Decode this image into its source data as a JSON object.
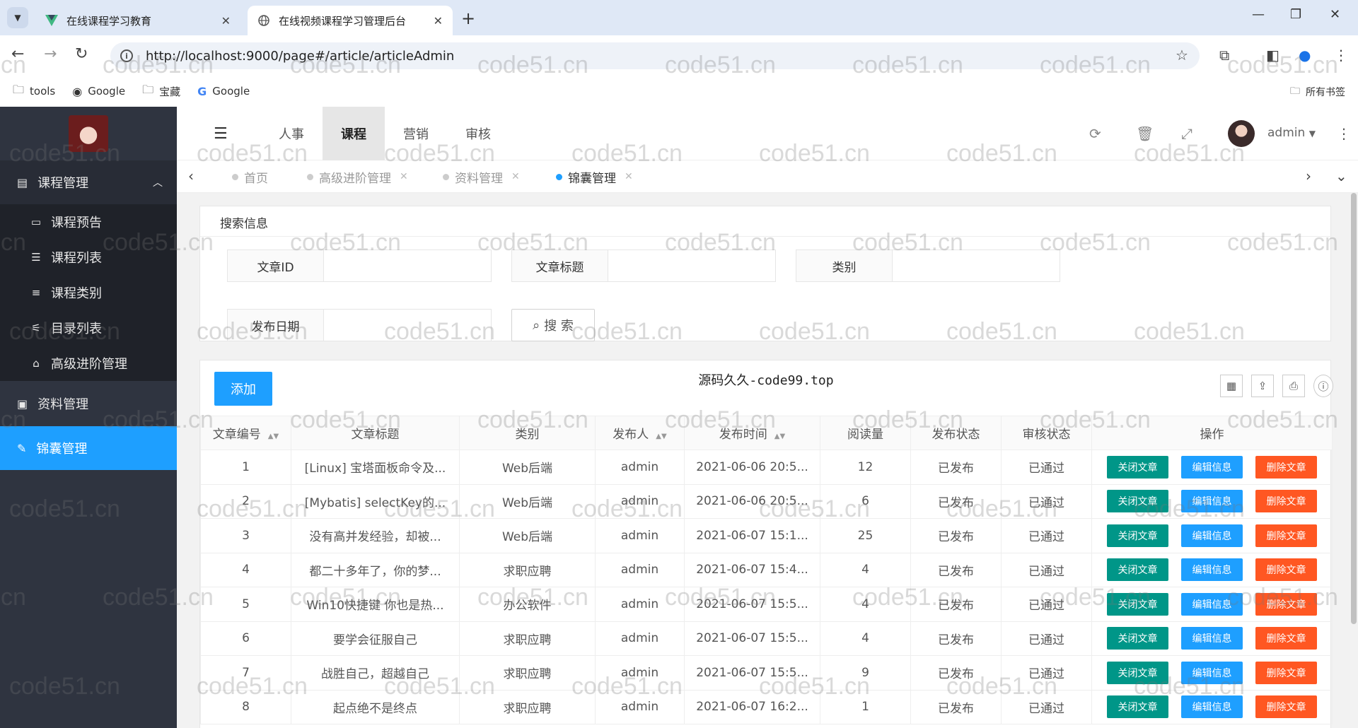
{
  "browser": {
    "tabs": [
      {
        "title": "在线课程学习教育",
        "icon": "vue-logo-icon"
      },
      {
        "title": "在线视频课程学习管理后台",
        "icon": "globe-icon"
      }
    ],
    "url": "http://localhost:9000/page#/article/articleAdmin",
    "bookmarks": [
      {
        "label": "tools",
        "icon": "folder-icon"
      },
      {
        "label": "Google",
        "icon": "globe-icon"
      },
      {
        "label": "宝藏",
        "icon": "folder-icon"
      },
      {
        "label": "Google",
        "icon": "google-icon"
      }
    ],
    "all_bookmarks": "所有书签"
  },
  "sidebar": {
    "group": "课程管理",
    "items": [
      "课程预告",
      "课程列表",
      "课程类别",
      "目录列表",
      "高级进阶管理"
    ],
    "plain": "资料管理",
    "active": "锦囊管理"
  },
  "header": {
    "nav": [
      "人事",
      "课程",
      "营销",
      "审核"
    ],
    "active_nav": "课程",
    "user": "admin"
  },
  "page_tabs": [
    "首页",
    "高级进阶管理",
    "资料管理",
    "锦囊管理"
  ],
  "search": {
    "title": "搜索信息",
    "fields": [
      "文章ID",
      "文章标题",
      "类别",
      "发布日期"
    ],
    "button": "搜 索"
  },
  "table": {
    "add_button": "添加",
    "title": "源码久久-code99.top",
    "headers": [
      "文章编号",
      "文章标题",
      "类别",
      "发布人",
      "发布时间",
      "阅读量",
      "发布状态",
      "审核状态",
      "操作"
    ],
    "op_labels": [
      "关闭文章",
      "编辑信息",
      "删除文章"
    ],
    "rows": [
      {
        "id": "1",
        "title": "[Linux] 宝塔面板命令及...",
        "category": "Web后端",
        "author": "admin",
        "time": "2021-06-06 20:5...",
        "reads": "12",
        "pub": "已发布",
        "audit": "已通过"
      },
      {
        "id": "2",
        "title": "[Mybatis] selectKey的...",
        "category": "Web后端",
        "author": "admin",
        "time": "2021-06-06 20:5...",
        "reads": "6",
        "pub": "已发布",
        "audit": "已通过"
      },
      {
        "id": "3",
        "title": "没有高并发经验，却被...",
        "category": "Web后端",
        "author": "admin",
        "time": "2021-06-07 15:1...",
        "reads": "25",
        "pub": "已发布",
        "audit": "已通过"
      },
      {
        "id": "4",
        "title": "都二十多年了，你的梦...",
        "category": "求职应聘",
        "author": "admin",
        "time": "2021-06-07 15:4...",
        "reads": "4",
        "pub": "已发布",
        "audit": "已通过"
      },
      {
        "id": "5",
        "title": "Win10快捷键 你也是热...",
        "category": "办公软件",
        "author": "admin",
        "time": "2021-06-07 15:5...",
        "reads": "4",
        "pub": "已发布",
        "audit": "已通过"
      },
      {
        "id": "6",
        "title": "要学会征服自己",
        "category": "求职应聘",
        "author": "admin",
        "time": "2021-06-07 15:5...",
        "reads": "4",
        "pub": "已发布",
        "audit": "已通过"
      },
      {
        "id": "7",
        "title": "战胜自己，超越自己",
        "category": "求职应聘",
        "author": "admin",
        "time": "2021-06-07 15:5...",
        "reads": "9",
        "pub": "已发布",
        "audit": "已通过"
      },
      {
        "id": "8",
        "title": "起点绝不是终点",
        "category": "求职应聘",
        "author": "admin",
        "time": "2021-06-07 16:2...",
        "reads": "1",
        "pub": "已发布",
        "audit": "已通过"
      }
    ]
  },
  "watermark": "code51.cn",
  "colors": {
    "accent": "#1e9fff",
    "sidebar": "#2f3440",
    "close": "#009688",
    "delete": "#ff5722",
    "status_green": "#1aa01a"
  }
}
